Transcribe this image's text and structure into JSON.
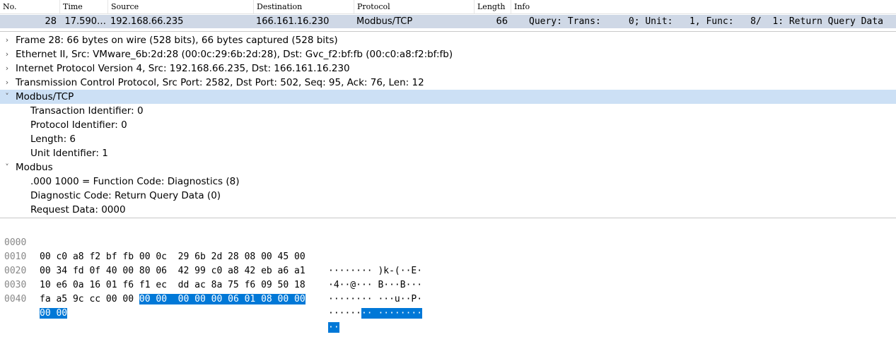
{
  "packet_list": {
    "columns": [
      "No.",
      "Time",
      "Source",
      "Destination",
      "Protocol",
      "Length",
      "Info"
    ],
    "selected_row": {
      "no": "28",
      "time": "17.590…",
      "source": "192.168.66.235",
      "destination": "166.161.16.230",
      "protocol": "Modbus/TCP",
      "length": "66",
      "info": "Query: Trans:     0; Unit:   1, Func:   8/  1: Return Query Data"
    }
  },
  "details": [
    {
      "text": "Frame 28: 66 bytes on wire (528 bits), 66 bytes captured (528 bits)",
      "expander": "›"
    },
    {
      "text": "Ethernet II, Src: VMware_6b:2d:28 (00:0c:29:6b:2d:28), Dst: Gvc_f2:bf:fb (00:c0:a8:f2:bf:fb)",
      "expander": "›"
    },
    {
      "text": "Internet Protocol Version 4, Src: 192.168.66.235, Dst: 166.161.16.230",
      "expander": "›"
    },
    {
      "text": "Transmission Control Protocol, Src Port: 2582, Dst Port: 502, Seq: 95, Ack: 76, Len: 12",
      "expander": "›"
    },
    {
      "text": "Modbus/TCP",
      "expander": "˅"
    },
    {
      "text": "Transaction Identifier: 0",
      "expander": ""
    },
    {
      "text": "Protocol Identifier: 0",
      "expander": ""
    },
    {
      "text": "Length: 6",
      "expander": ""
    },
    {
      "text": "Unit Identifier: 1",
      "expander": ""
    },
    {
      "text": "Modbus",
      "expander": "˅"
    },
    {
      "text": ".000 1000 = Function Code: Diagnostics (8)",
      "expander": ""
    },
    {
      "text": "Diagnostic Code: Return Query Data (0)",
      "expander": ""
    },
    {
      "text": "Request Data: 0000",
      "expander": ""
    }
  ],
  "bytes": [
    {
      "offset": "0000",
      "hex": "00 c0 a8 f2 bf fb 00 0c  29 6b 2d 28 08 00 45 00",
      "ascii": "········ )k-(··E·"
    },
    {
      "offset": "0010",
      "hex": "00 34 fd 0f 40 00 80 06  42 99 c0 a8 42 eb a6 a1",
      "ascii": "·4··@··· B···B···"
    },
    {
      "offset": "0020",
      "hex": "10 e6 0a 16 01 f6 f1 ec  dd ac 8a 75 f6 09 50 18",
      "ascii": "········ ···u··P·"
    },
    {
      "offset": "0030",
      "hex_plain": "fa a5 9c cc 00 00 ",
      "hex_hl": "00 00  00 00 00 06 01 08 00 00",
      "ascii_plain": "······",
      "ascii_hl": "·· ········"
    },
    {
      "offset": "0040",
      "hex_hl": "00 00",
      "ascii_hl": "··"
    }
  ]
}
